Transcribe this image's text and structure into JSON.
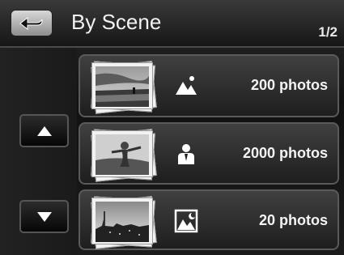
{
  "header": {
    "title": "By Scene",
    "page_indicator": "1/2"
  },
  "icons": {
    "back": "back-arrow-icon",
    "up": "up-arrow-icon",
    "down": "down-arrow-icon"
  },
  "scenes": [
    {
      "icon": "landscape-icon",
      "count_label": "200 photos"
    },
    {
      "icon": "portrait-icon",
      "count_label": "2000 photos"
    },
    {
      "icon": "night-scene-icon",
      "count_label": "20 photos"
    }
  ]
}
